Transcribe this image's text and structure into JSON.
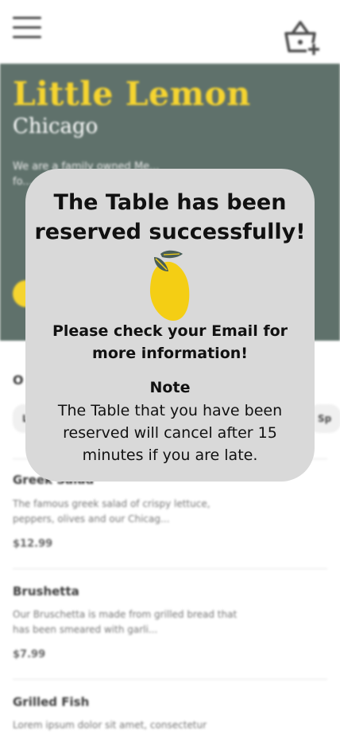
{
  "header": {
    "menu_icon": "hamburger-menu-icon",
    "cart_icon": "basket-add-icon"
  },
  "hero": {
    "title": "Little Lemon",
    "subtitle": "Chicago",
    "description": "We are a family owned Me... fo... re... m...",
    "colors": {
      "background": "#495e57",
      "accent": "#f4ce14"
    }
  },
  "menu": {
    "section_title": "O",
    "chips": [
      "L",
      "Sp"
    ],
    "items": [
      {
        "name": "Greek Salad",
        "description": "The famous greek salad of crispy lettuce, peppers, olives and our Chicag...",
        "price": "$12.99"
      },
      {
        "name": "Brushetta",
        "description": "Our Bruschetta is made from grilled bread that has been smeared with garli...",
        "price": "$7.99"
      },
      {
        "name": "Grilled Fish",
        "description": "Lorem ipsum dolor sit amet, consectetur",
        "price": ""
      }
    ]
  },
  "modal": {
    "title": "The Table has been reserved successfully!",
    "message": "Please check your Email for more information!",
    "note_title": "Note",
    "note": "The Table that you have been reserved will cancel after 15 minutes if you are late.",
    "icon": "lemon-icon"
  }
}
